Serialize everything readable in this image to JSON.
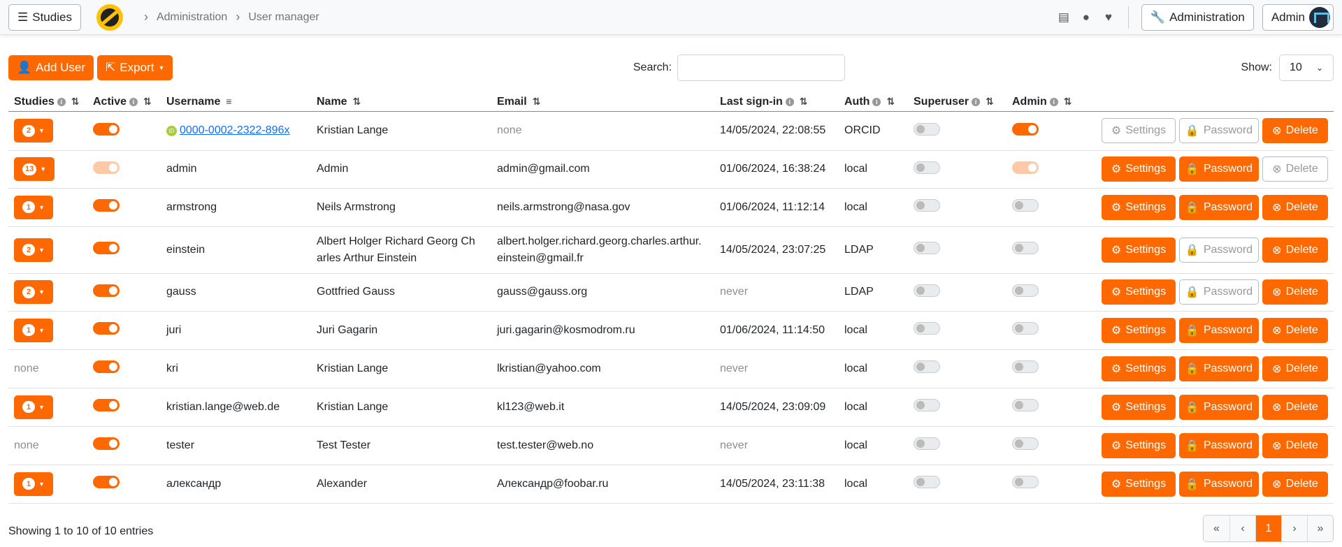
{
  "nav": {
    "studies_label": "Studies",
    "breadcrumbs": [
      "Administration",
      "User manager"
    ],
    "admin_button": "Administration",
    "user_button": "Admin"
  },
  "toolbar": {
    "add_user": "Add User",
    "export": "Export",
    "search_label": "Search:",
    "search_value": "",
    "show_label": "Show:",
    "show_value": "10"
  },
  "columns": [
    "Studies",
    "Active",
    "Username",
    "Name",
    "Email",
    "Last sign-in",
    "Auth",
    "Superuser",
    "Admin"
  ],
  "buttons": {
    "settings": "Settings",
    "password": "Password",
    "delete": "Delete"
  },
  "rows": [
    {
      "studies": "2",
      "active": true,
      "active_disabled": false,
      "username": "0000-0002-2322-896x",
      "orcid": true,
      "name": "Kristian Lange",
      "email": "none",
      "email_muted": true,
      "last_signin": "14/05/2024, 22:08:55",
      "signin_muted": false,
      "auth": "ORCID",
      "superuser": false,
      "admin": true,
      "admin_disabled": false,
      "settings_disabled": true,
      "password_disabled": true,
      "delete_disabled": false
    },
    {
      "studies": "13",
      "active": true,
      "active_disabled": true,
      "username": "admin",
      "orcid": false,
      "name": "Admin",
      "email": "admin@gmail.com",
      "email_muted": false,
      "last_signin": "01/06/2024, 16:38:24",
      "signin_muted": false,
      "auth": "local",
      "superuser": false,
      "admin": true,
      "admin_disabled": true,
      "settings_disabled": false,
      "password_disabled": false,
      "delete_disabled": true
    },
    {
      "studies": "1",
      "active": true,
      "active_disabled": false,
      "username": "armstrong",
      "orcid": false,
      "name": "Neils Armstrong",
      "email": "neils.armstrong@nasa.gov",
      "email_muted": false,
      "last_signin": "01/06/2024, 11:12:14",
      "signin_muted": false,
      "auth": "local",
      "superuser": false,
      "admin": false,
      "admin_disabled": false,
      "settings_disabled": false,
      "password_disabled": false,
      "delete_disabled": false
    },
    {
      "studies": "2",
      "active": true,
      "active_disabled": false,
      "username": "einstein",
      "orcid": false,
      "name": "Albert Holger Richard Georg Charles Arthur Einstein",
      "email": "albert.holger.richard.georg.charles.arthur.einstein@gmail.fr",
      "email_muted": false,
      "last_signin": "14/05/2024, 23:07:25",
      "signin_muted": false,
      "auth": "LDAP",
      "superuser": false,
      "admin": false,
      "admin_disabled": false,
      "settings_disabled": false,
      "password_disabled": true,
      "delete_disabled": false
    },
    {
      "studies": "2",
      "active": true,
      "active_disabled": false,
      "username": "gauss",
      "orcid": false,
      "name": "Gottfried Gauss",
      "email": "gauss@gauss.org",
      "email_muted": false,
      "last_signin": "never",
      "signin_muted": true,
      "auth": "LDAP",
      "superuser": false,
      "admin": false,
      "admin_disabled": false,
      "settings_disabled": false,
      "password_disabled": true,
      "delete_disabled": false
    },
    {
      "studies": "1",
      "active": true,
      "active_disabled": false,
      "username": "juri",
      "orcid": false,
      "name": "Juri Gagarin",
      "email": "juri.gagarin@kosmodrom.ru",
      "email_muted": false,
      "last_signin": "01/06/2024, 11:14:50",
      "signin_muted": false,
      "auth": "local",
      "superuser": false,
      "admin": false,
      "admin_disabled": false,
      "settings_disabled": false,
      "password_disabled": false,
      "delete_disabled": false
    },
    {
      "studies": "none",
      "active": true,
      "active_disabled": false,
      "username": "kri",
      "orcid": false,
      "name": "Kristian Lange",
      "email": "lkristian@yahoo.com",
      "email_muted": false,
      "last_signin": "never",
      "signin_muted": true,
      "auth": "local",
      "superuser": false,
      "admin": false,
      "admin_disabled": false,
      "settings_disabled": false,
      "password_disabled": false,
      "delete_disabled": false
    },
    {
      "studies": "1",
      "active": true,
      "active_disabled": false,
      "username": "kristian.lange@web.de",
      "orcid": false,
      "name": "Kristian Lange",
      "email": "kl123@web.it",
      "email_muted": false,
      "last_signin": "14/05/2024, 23:09:09",
      "signin_muted": false,
      "auth": "local",
      "superuser": false,
      "admin": false,
      "admin_disabled": false,
      "settings_disabled": false,
      "password_disabled": false,
      "delete_disabled": false
    },
    {
      "studies": "none",
      "active": true,
      "active_disabled": false,
      "username": "tester",
      "orcid": false,
      "name": "Test Tester",
      "email": "test.tester@web.no",
      "email_muted": false,
      "last_signin": "never",
      "signin_muted": true,
      "auth": "local",
      "superuser": false,
      "admin": false,
      "admin_disabled": false,
      "settings_disabled": false,
      "password_disabled": false,
      "delete_disabled": false
    },
    {
      "studies": "1",
      "active": true,
      "active_disabled": false,
      "username": "александр",
      "orcid": false,
      "name": "Alexander",
      "email": "Александр@foobar.ru",
      "email_muted": false,
      "last_signin": "14/05/2024, 23:11:38",
      "signin_muted": false,
      "auth": "local",
      "superuser": false,
      "admin": false,
      "admin_disabled": false,
      "settings_disabled": false,
      "password_disabled": false,
      "delete_disabled": false
    }
  ],
  "footer": {
    "info": "Showing 1 to 10 of 10 entries",
    "current_page": "1"
  },
  "colors": {
    "accent": "#fd6800",
    "link": "#0d6efd",
    "muted": "#8a8f94"
  }
}
